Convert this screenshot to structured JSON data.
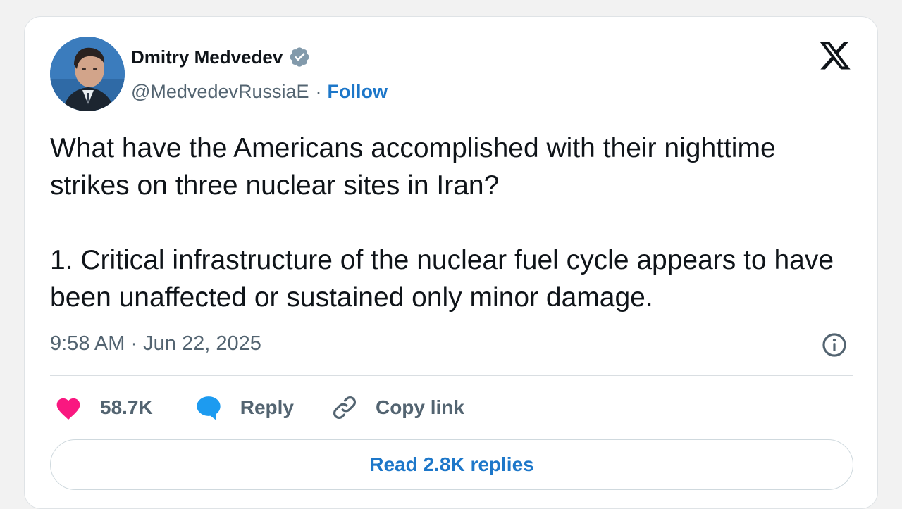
{
  "tweet": {
    "author_name": "Dmitry Medvedev",
    "handle": "@MedvedevRussiaE",
    "separator": "·",
    "follow_label": "Follow",
    "text_paragraphs": [
      "What have the Americans accomplished with their nighttime strikes on three nuclear sites in Iran?",
      "1. Critical infrastructure of the nuclear fuel cycle appears to have been unaffected or sustained only minor damage."
    ],
    "timestamp": "9:58 AM · Jun 22, 2025"
  },
  "actions": {
    "like_count": "58.7K",
    "reply_label": "Reply",
    "copy_link_label": "Copy link"
  },
  "read_replies_label": "Read 2.8K replies",
  "icons": {
    "verified": "verified-badge-icon",
    "platform": "x-logo-icon",
    "info": "info-icon",
    "like": "heart-icon",
    "reply": "speech-bubble-icon",
    "copy": "link-icon"
  },
  "colors": {
    "accent_blue": "#1d77c9",
    "like_pink": "#f91880",
    "reply_blue": "#1d9bf0",
    "verified_gray": "#829aab",
    "text_primary": "#0f1419",
    "text_secondary": "#536471"
  }
}
